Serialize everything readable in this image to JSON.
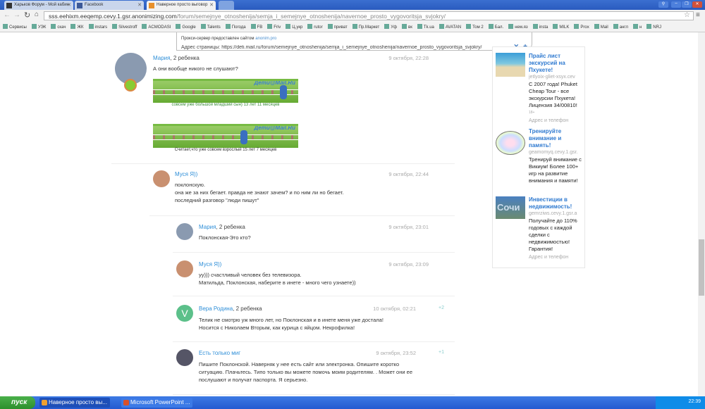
{
  "browser": {
    "tabs": [
      {
        "label": "Харьков Форум - Мой кабин"
      },
      {
        "label": "Facebook"
      },
      {
        "label": "Наверное просто выговор"
      }
    ],
    "url_host": "sss.eehixm.eeqemp.cevy.1.gsr.anonimizing.com",
    "url_path": "/forum/semejnye_otnoshenija/semja_i_semejnye_otnoshenija/navernoe_prosto_vygovoritsja_svjokry/",
    "bookmarks": [
      "Сервисы",
      "УЭК",
      "скач",
      "ЖК",
      "instars",
      "Silvestroff",
      "ACMODASI",
      "Google",
      "Talents",
      "Погода",
      "FB",
      "Friv",
      "Ц.укр",
      "rutor",
      "приват",
      "Пр.Маркет",
      "Уф",
      "вк",
      "Tk.ua",
      "AVATAN",
      "Том 2",
      "Бал.",
      "нем.яз",
      "insta",
      "MILK",
      "Prox",
      "Mail",
      "англ",
      "н",
      "NRJ"
    ]
  },
  "proxy": {
    "notice": "Прокси-сервер предоставлен сайтом",
    "site": "anonim.pro",
    "address_label": "Адрес страницы:",
    "address": "https://deti.mail.ru/forum/semejnye_otnoshenija/semja_i_semejnye_otnoshenija/navernoe_prosto_vygovoritsja_svjokry/"
  },
  "posts": [
    {
      "author": "Мария",
      "suffix": ", 2 ребенка",
      "date": "9 октября, 22:28",
      "lines": [
        "А они вообще никого не слушают?"
      ],
      "banners": [
        {
          "logo": "Дети@Mail.Ru",
          "caption": "совсем уже большой младший сын) 13 лет 11 месяцев"
        },
        {
          "logo": "Дети@Mail.Ru",
          "caption": "Считает,что уже совсем взрослый 15 лет 7 месяцев"
        }
      ]
    },
    {
      "author": "Муся Я))",
      "suffix": "",
      "date": "9 октября, 22:44",
      "lines": [
        "поклонскую.",
        "она же за них бегает. правда не знают зачем? и по ним ли но бегает.",
        "последний разговор \"люди пишут\""
      ]
    },
    {
      "author": "Мария",
      "suffix": ", 2 ребенка",
      "date": "9 октября, 23:01",
      "lines": [
        "Поклонская-Это кто?"
      ]
    },
    {
      "author": "Муся Я))",
      "suffix": "",
      "date": "9 октября, 23:09",
      "lines": [
        "уу))) счастливый человек без телевизора.",
        "Матильда, Поклонская, наберите в инете - много чего узнаете))"
      ]
    },
    {
      "author": "Вера Родина",
      "suffix": ", 2 ребенка",
      "date": "10 октября, 02:21",
      "votes": "+2",
      "avatar_letter": "V",
      "lines": [
        "Телик не смотрю уж много лет, но Поклонская и в инете меня уже достала!",
        "Носится с Николаем Вторым, как курица с яйцом. Некрофилка!"
      ]
    },
    {
      "author": "Есть только миг",
      "suffix": "",
      "date": "9 октября, 23:52",
      "votes": "+1",
      "lines": [
        "Пишите Поклонской. Наверняк у нее есть сайт или электронка. Опишите коротко",
        "ситуацию. Плачьтесь. Типо только вы можете помочь моим родителям. . Может они ее",
        "послушают и получат паспорта. Я серьезно."
      ]
    }
  ],
  "ads": [
    {
      "title": "Прайс лист экскурсий на Пхукете!",
      "domain": "jetlyoix-gliet-xsyx.cev",
      "text": "С 2007 года! Phuket Cheap Tour - все экскурсии Пхукета! Лицензия 34/00810!",
      "age": "18+",
      "contact": "Адрес и телефон"
    },
    {
      "title": "Тренируйте внимание и память!",
      "domain": "geamomyq.cevy.1.gsr.",
      "text": "Тренируй внимание с Викиум! Более 100+ игр на развитие внимания и памяти!"
    },
    {
      "title": "Инвестиции в недвижимость!",
      "domain": "gemrziws.cevy.1.gsr.a",
      "text": "Получайте до 110% годовых с каждой сделки с недвижимостью! Гарантия!",
      "contact": "Адрес и телефон",
      "img_text": "Сочи"
    }
  ],
  "taskbar": {
    "start": "пуск",
    "tasks": [
      "Наверное просто вы...",
      "Microsoft PowerPoint ..."
    ],
    "clock": "22:39"
  },
  "colors": {
    "link": "#2f8fd8",
    "taskbar": "#245ad0",
    "vera_avatar": "#5cc08a"
  }
}
